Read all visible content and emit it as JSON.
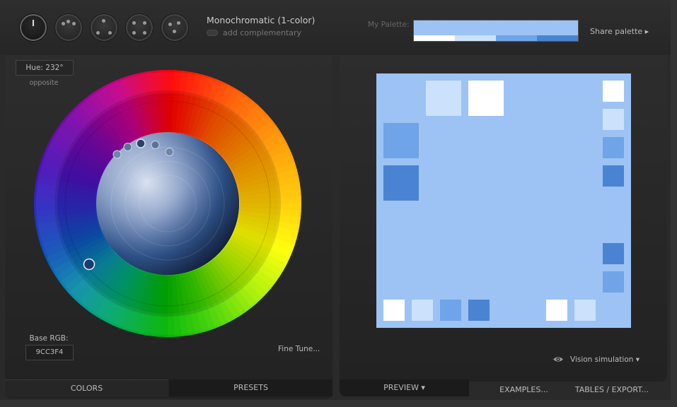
{
  "scheme": {
    "title": "Monochromatic (1-color)",
    "complementary_label": "add complementary",
    "icons": [
      "mono-scheme-icon",
      "adjacent-scheme-icon",
      "triad-scheme-icon",
      "tetrad-scheme-icon",
      "freestyle-scheme-icon"
    ]
  },
  "palette": {
    "label": "My Palette:",
    "share_label": "Share palette ▸",
    "colors": [
      "#9cc3f4",
      "#ffffff",
      "#cce1fb",
      "#6fa4e8",
      "#4b83d3"
    ]
  },
  "wheel": {
    "hue_label": "Hue: 232°",
    "opposite_label": "opposite",
    "base_rgb_label": "Base RGB:",
    "base_rgb_value": "9CC3F4",
    "fine_tune_label": "Fine Tune..."
  },
  "left_tabs": {
    "colors": "COLORS",
    "presets": "PRESETS"
  },
  "right_tabs": {
    "preview": "PREVIEW ▾",
    "examples": "EXAMPLES...",
    "tables": "TABLES / EXPORT..."
  },
  "vision": {
    "label": "Vision simulation ▾"
  },
  "preview_colors": {
    "background": "#9cc3f4",
    "white": "#ffffff",
    "light": "#cce1fb",
    "mid": "#6fa4e8",
    "dark": "#4b83d3"
  }
}
